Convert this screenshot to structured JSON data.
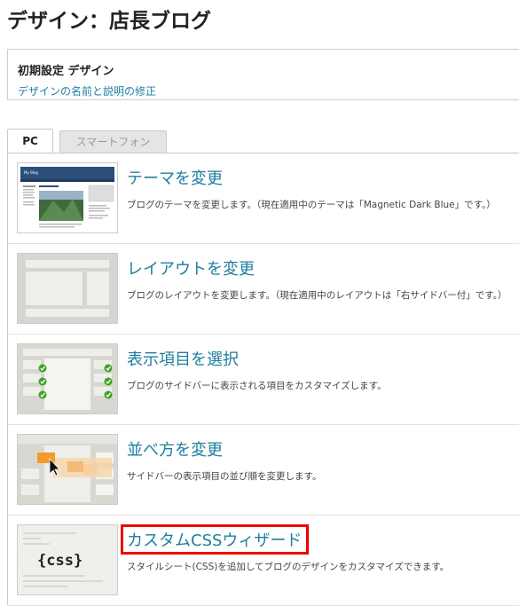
{
  "page": {
    "title": "デザイン：店長ブログ"
  },
  "design": {
    "name": "初期設定 デザイン",
    "edit_link": "デザインの名前と説明の修正"
  },
  "tabs": [
    {
      "label": "PC"
    },
    {
      "label": "スマートフォン"
    }
  ],
  "items": [
    {
      "title": "テーマを変更",
      "desc": "ブログのテーマを変更します。（現在適用中のテーマは「Magnetic Dark Blue」です。）"
    },
    {
      "title": "レイアウトを変更",
      "desc": "ブログのレイアウトを変更します。（現在適用中のレイアウトは「右サイドバー付」です。）"
    },
    {
      "title": "表示項目を選択",
      "desc": "ブログのサイドバーに表示される項目をカスタマイズします。"
    },
    {
      "title": "並べ方を変更",
      "desc": "サイドバーの表示項目の並び順を変更します。"
    },
    {
      "title": "カスタムCSSウィザード",
      "desc": "スタイルシート(CSS)を追加してブログのデザインをカスタマイズできます。"
    }
  ],
  "thumb_text": {
    "theme_blog_name": "My Blog",
    "css_label": "{css}"
  },
  "colors": {
    "link": "#1f7ea0",
    "highlight": "#e00000",
    "check": "#3aa324",
    "drag_orange": "#f39a2a"
  }
}
